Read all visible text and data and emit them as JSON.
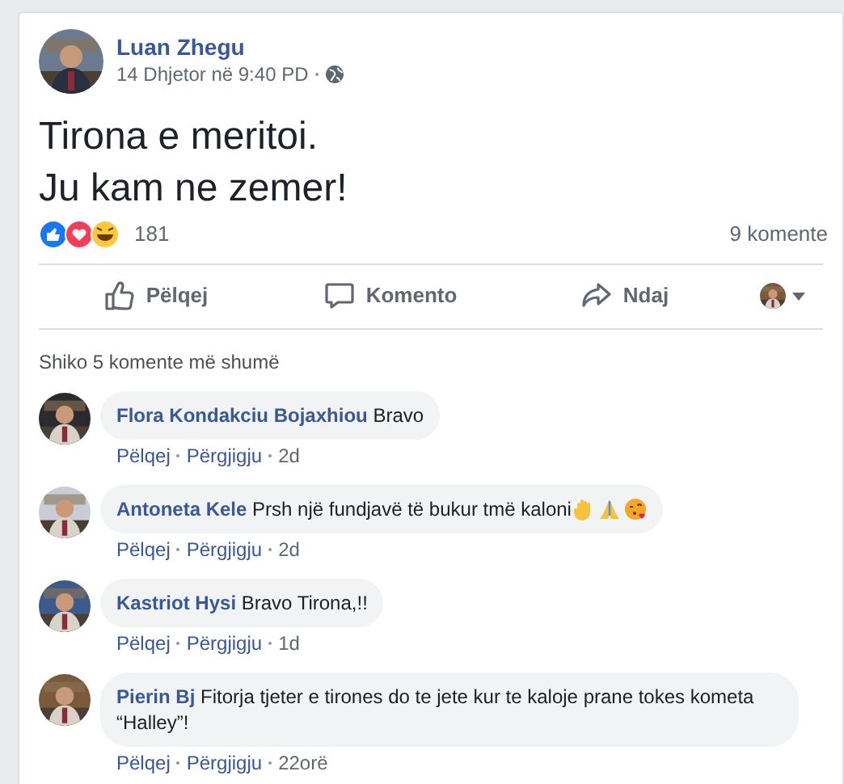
{
  "post": {
    "author": "Luan Zhegu",
    "timestamp": "14 Dhjetor në 9:40 PD",
    "text_lines": [
      "Tirona e meritoi.",
      "Ju kam ne zemer!"
    ],
    "reaction_count": "181",
    "comment_count": "9 komente"
  },
  "actions": [
    {
      "kind": "like",
      "label": "Pëlqej"
    },
    {
      "kind": "comment",
      "label": "Komento"
    },
    {
      "kind": "share",
      "label": "Ndaj"
    }
  ],
  "more_comments": "Shiko 5 komente më shumë",
  "comments": [
    {
      "author": "Flora Kondakciu Bojaxhiou",
      "text": "Bravo",
      "emojis": false,
      "like": "Pëlqej",
      "reply": "Përgjigju",
      "time": "2d"
    },
    {
      "author": "Antoneta Kele",
      "text": "Prsh një fundjavë të bukur tmë kaloni",
      "emojis": true,
      "like": "Pëlqej",
      "reply": "Përgjigju",
      "time": "2d"
    },
    {
      "author": "Kastriot Hysi",
      "text": "Bravo Tirona,!!",
      "emojis": false,
      "like": "Pëlqej",
      "reply": "Përgjigju",
      "time": "1d"
    },
    {
      "author": "Pierin Bj",
      "text": "Fitorja tjeter e tirones do te jete kur te kaloje prane tokes kometa “Halley”!",
      "emojis": false,
      "like": "Pëlqej",
      "reply": "Përgjigju",
      "time": "22orë"
    }
  ]
}
